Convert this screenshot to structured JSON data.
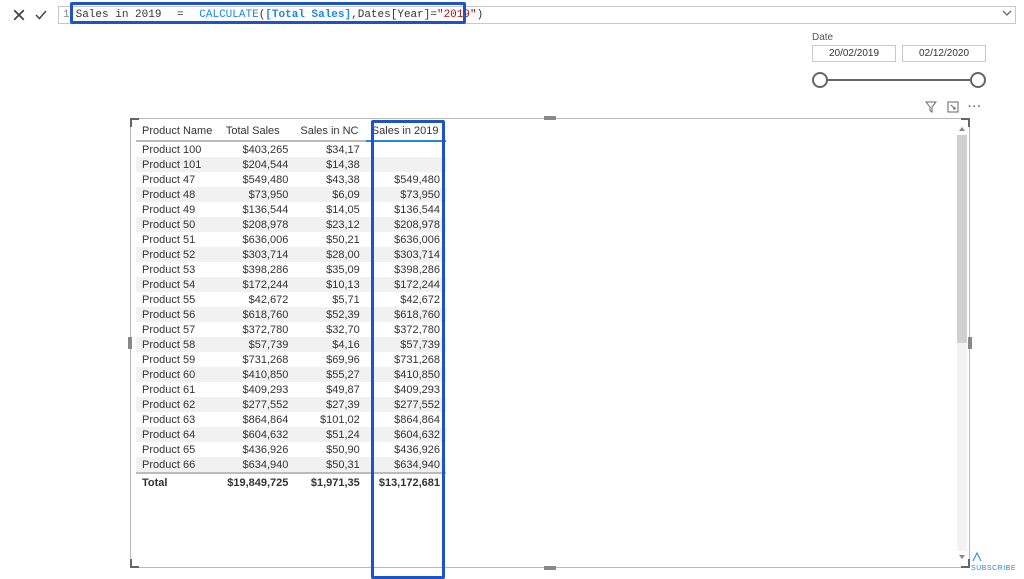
{
  "formula": {
    "line_no": "1",
    "measure": "Sales in 2019",
    "eq": "=",
    "func": "CALCULATE",
    "open": "(",
    "arg1": " [Total Sales]",
    "comma": ",",
    "arg2a": " Dates[Year] ",
    "eq2": "=",
    "str_open": " \"",
    "str_val": "2019",
    "str_close": "\" ",
    "close": ")"
  },
  "slicer": {
    "label": "Date",
    "from": "20/02/2019",
    "to": "02/12/2020"
  },
  "table": {
    "headers": [
      "Product Name",
      "Total Sales",
      "Sales in NC",
      "Sales in 2019"
    ],
    "rows": [
      [
        "Product 100",
        "$403,265",
        "$34,17",
        ""
      ],
      [
        "Product 101",
        "$204,544",
        "$14,38",
        ""
      ],
      [
        "Product 47",
        "$549,480",
        "$43,38",
        "$549,480"
      ],
      [
        "Product 48",
        "$73,950",
        "$6,09",
        "$73,950"
      ],
      [
        "Product 49",
        "$136,544",
        "$14,05",
        "$136,544"
      ],
      [
        "Product 50",
        "$208,978",
        "$23,12",
        "$208,978"
      ],
      [
        "Product 51",
        "$636,006",
        "$50,21",
        "$636,006"
      ],
      [
        "Product 52",
        "$303,714",
        "$28,00",
        "$303,714"
      ],
      [
        "Product 53",
        "$398,286",
        "$35,09",
        "$398,286"
      ],
      [
        "Product 54",
        "$172,244",
        "$10,13",
        "$172,244"
      ],
      [
        "Product 55",
        "$42,672",
        "$5,71",
        "$42,672"
      ],
      [
        "Product 56",
        "$618,760",
        "$52,39",
        "$618,760"
      ],
      [
        "Product 57",
        "$372,780",
        "$32,70",
        "$372,780"
      ],
      [
        "Product 58",
        "$57,739",
        "$4,16",
        "$57,739"
      ],
      [
        "Product 59",
        "$731,268",
        "$69,96",
        "$731,268"
      ],
      [
        "Product 60",
        "$410,850",
        "$55,27",
        "$410,850"
      ],
      [
        "Product 61",
        "$409,293",
        "$49,87",
        "$409,293"
      ],
      [
        "Product 62",
        "$277,552",
        "$27,39",
        "$277,552"
      ],
      [
        "Product 63",
        "$864,864",
        "$101,02",
        "$864,864"
      ],
      [
        "Product 64",
        "$604,632",
        "$51,24",
        "$604,632"
      ],
      [
        "Product 65",
        "$436,926",
        "$50,90",
        "$436,926"
      ],
      [
        "Product 66",
        "$634,940",
        "$50,31",
        "$634,940"
      ]
    ],
    "footer": [
      "Total",
      "$19,849,725",
      "$1,971,35",
      "$13,172,681"
    ]
  },
  "subscribe_label": "SUBSCRIBE"
}
